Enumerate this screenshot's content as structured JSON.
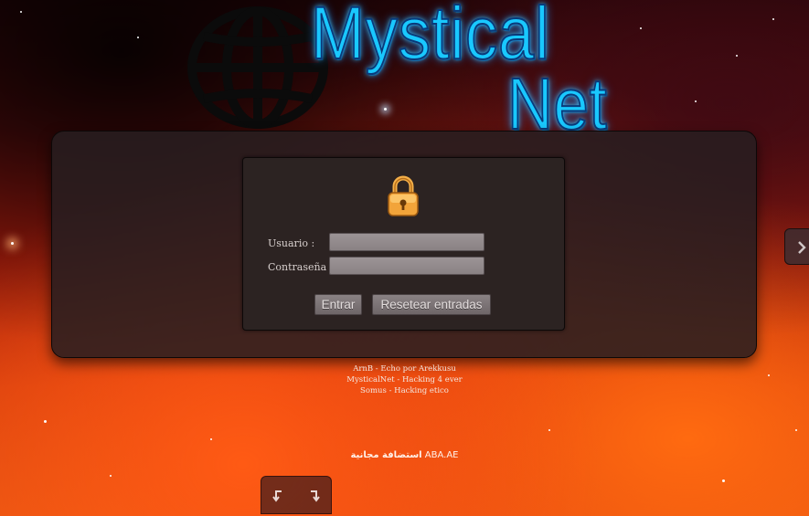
{
  "logo": {
    "line1": "Mystical",
    "line2": "Net",
    "globe_icon": "globe-icon"
  },
  "login": {
    "lock_icon": "lock-icon",
    "username_label": "Usuario :",
    "password_label": "Contraseña :",
    "username_value": "",
    "password_value": "",
    "submit_label": "Entrar",
    "reset_label": "Resetear entradas"
  },
  "side_nav": {
    "icon": "chevron-right-icon"
  },
  "credits": {
    "line1": "ArnB - Echo por Arekkusu",
    "line2": "MysticalNet - Hacking 4 ever",
    "line3": "Somus - Hacking etico"
  },
  "hosting": {
    "arabic": "استضافة مجانية",
    "domain": "ABA.AE"
  },
  "bottom_nav": {
    "back_icon": "undo-arrow-icon",
    "forward_icon": "redo-arrow-icon"
  },
  "colors": {
    "logo_accent": "#19c8ff",
    "lock_orange": "#f2a43a",
    "panel_bg": "#281e20"
  }
}
